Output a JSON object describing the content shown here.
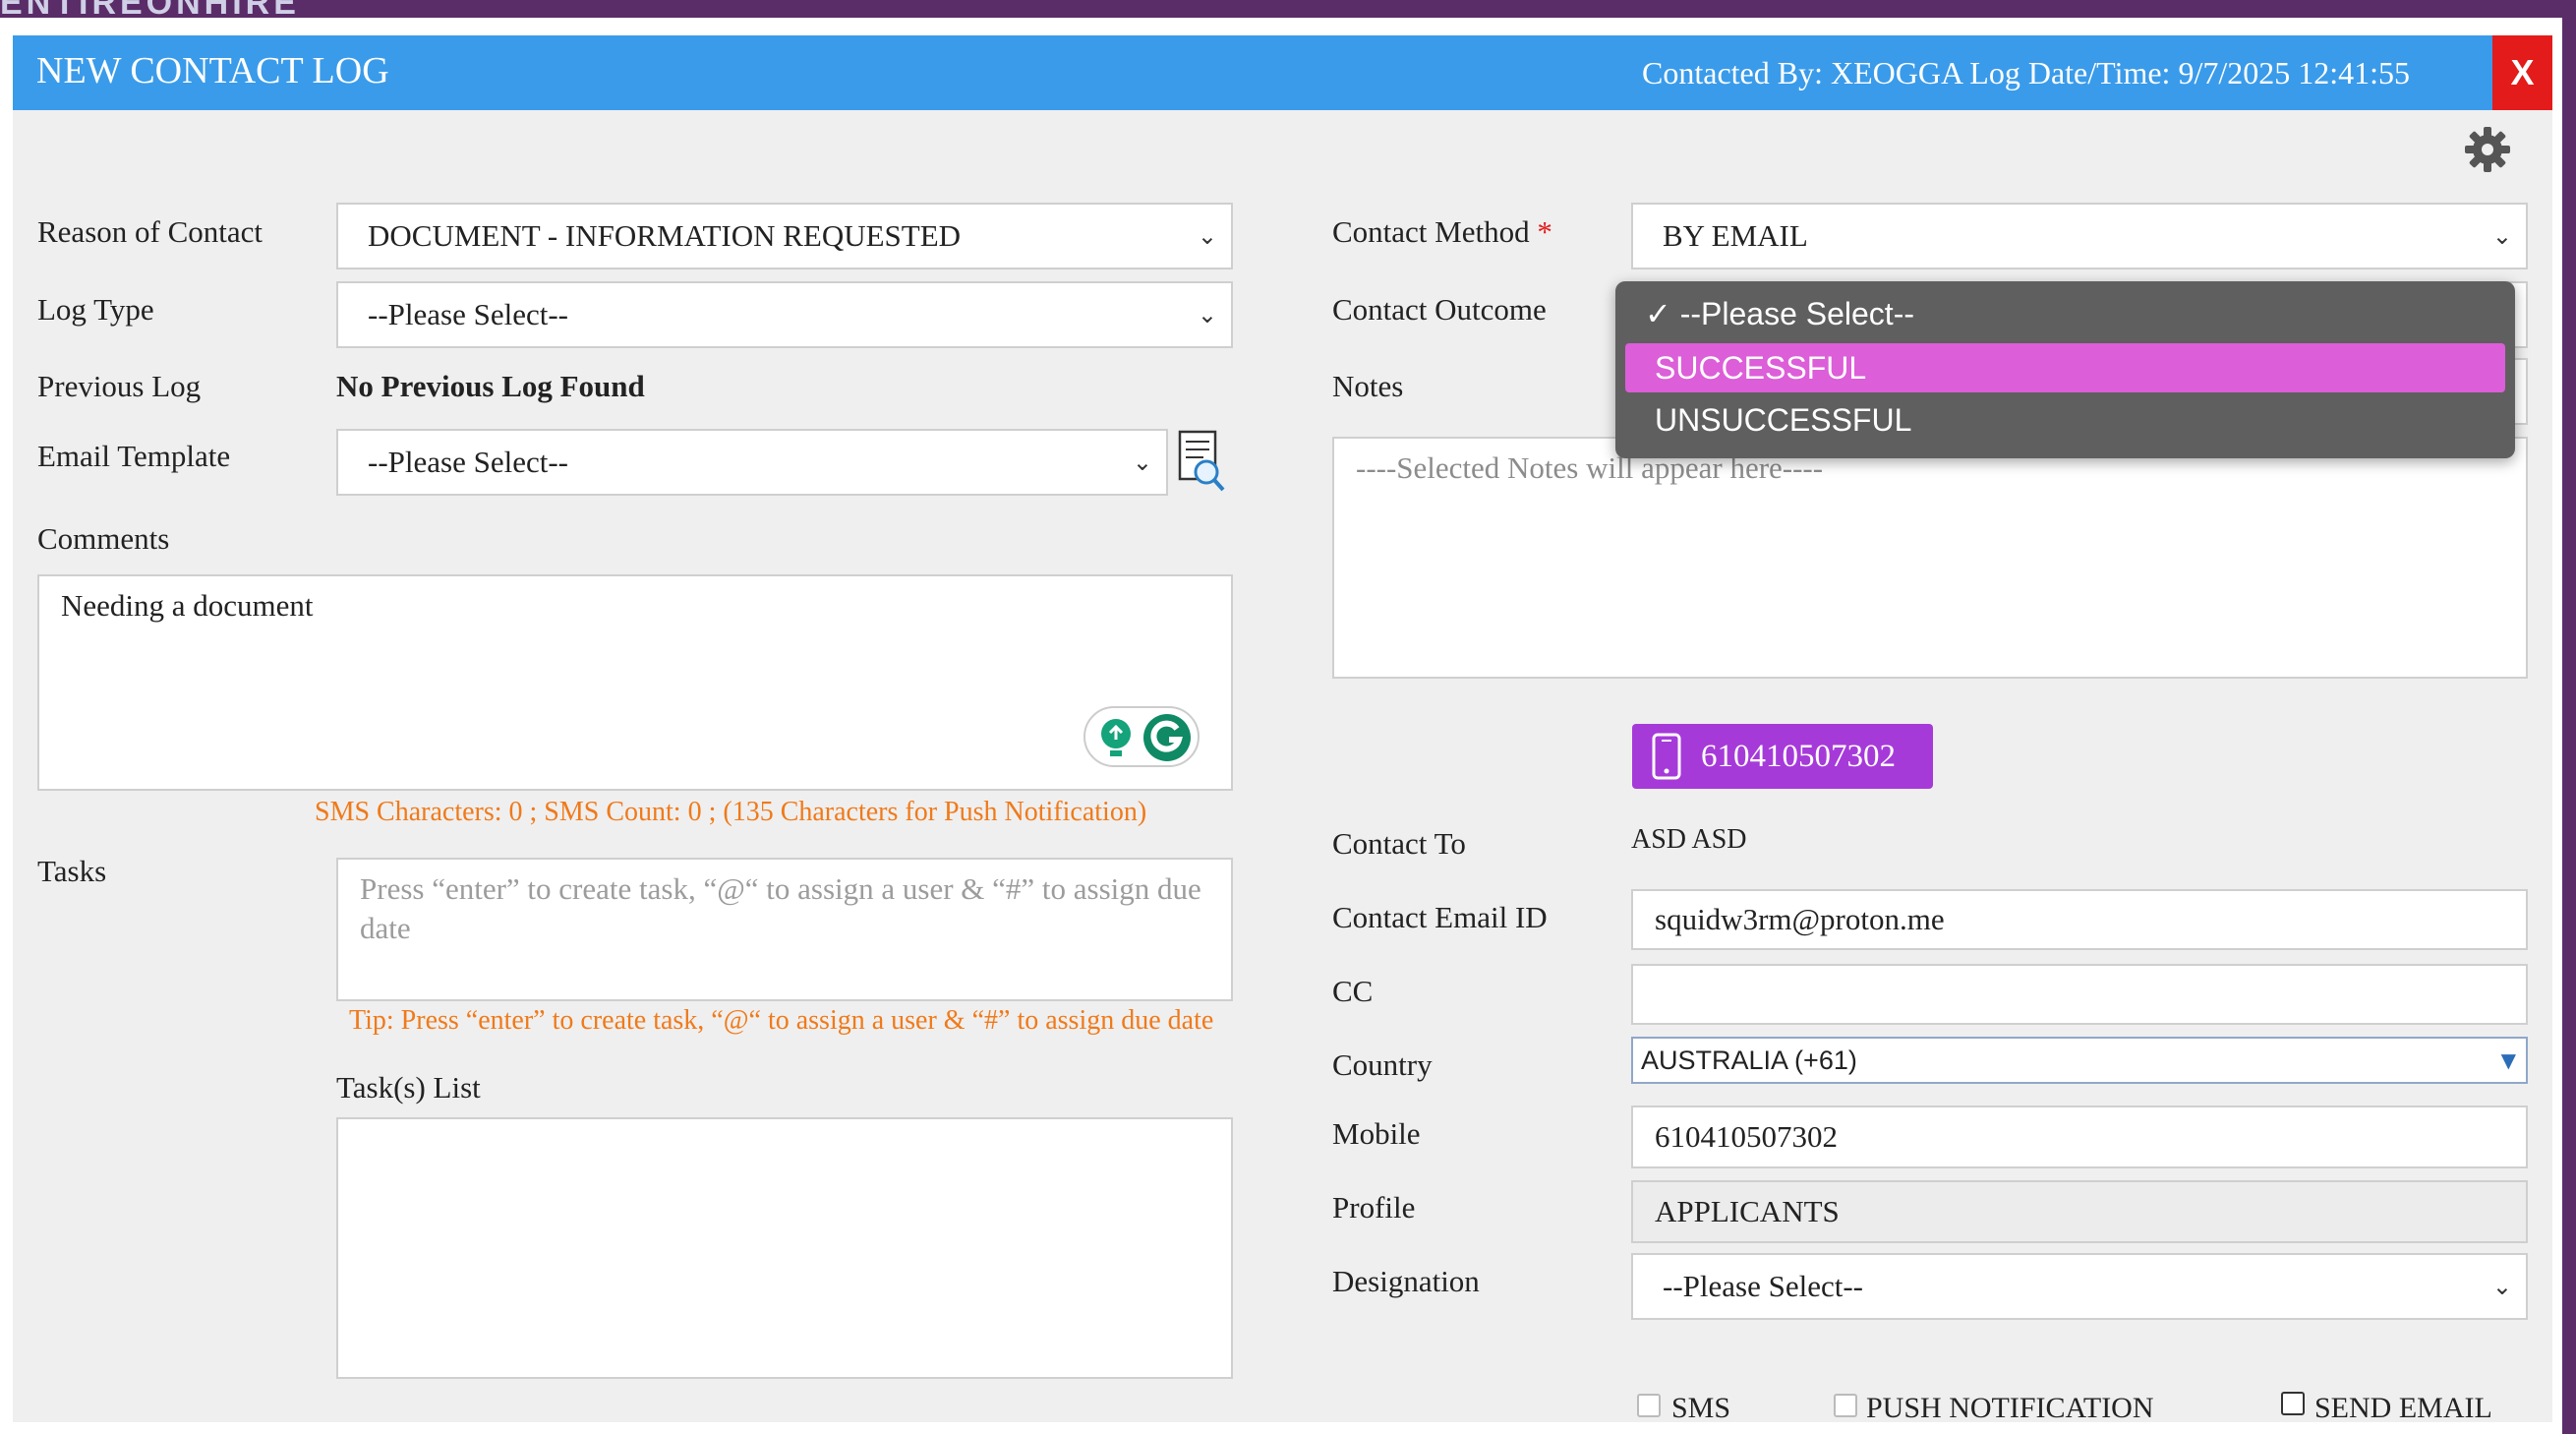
{
  "app": {
    "brand": "ENTIREONHIRE"
  },
  "header": {
    "title": "NEW CONTACT LOG",
    "meta": "Contacted By: XEOGGA  Log Date/Time: 9/7/2025 12:41:55",
    "close_label": "X"
  },
  "left": {
    "reason_label": "Reason of Contact",
    "reason_value": "DOCUMENT - INFORMATION REQUESTED",
    "logtype_label": "Log Type",
    "logtype_value": "--Please Select--",
    "prevlog_label": "Previous Log",
    "prevlog_value": "No Previous Log Found",
    "emailtpl_label": "Email Template",
    "emailtpl_value": "--Please Select--",
    "comments_label": "Comments",
    "comments_value": "Needing a document",
    "sms_counter": "SMS Characters: 0 ; SMS Count: 0 ; (135 Characters for Push Notification)",
    "tasks_label": "Tasks",
    "tasks_placeholder": "Press “enter” to create task, “@“ to assign a user & “#” to assign due date",
    "tasks_tip": "Tip: Press “enter” to create task, “@“ to assign a user & “#” to assign due date",
    "tasklist_label": "Task(s) List"
  },
  "right": {
    "method_label": "Contact Method",
    "required_mark": "*",
    "method_value": "BY EMAIL",
    "outcome_label": "Contact Outcome",
    "notes_label": "Notes",
    "notes_placeholder": "----Selected Notes will appear here----",
    "phone_badge": "610410507302",
    "contact_to_label": "Contact To",
    "contact_to_value": "ASD ASD",
    "email_label": "Contact Email ID",
    "email_value": "squidw3rm@proton.me",
    "cc_label": "CC",
    "cc_value": "",
    "country_label": "Country",
    "country_value": "AUSTRALIA (+61)",
    "mobile_label": "Mobile",
    "mobile_value": "610410507302",
    "profile_label": "Profile",
    "profile_value": "APPLICANTS",
    "designation_label": "Designation",
    "designation_value": "--Please Select--",
    "sms_check": "SMS",
    "push_check": "PUSH NOTIFICATION",
    "sendemail_check": "SEND EMAIL"
  },
  "outcome_dropdown": {
    "options": [
      {
        "label": "✓ --Please Select--",
        "selected": false
      },
      {
        "label": "SUCCESSFUL",
        "selected": true
      },
      {
        "label": "UNSUCCESSFUL",
        "selected": false
      }
    ]
  },
  "colors": {
    "header_blue": "#3a9bea",
    "close_red": "#e31b1b",
    "hint_orange": "#f07a1a",
    "badge_purple": "#a63ad9",
    "dropdown_highlight": "#dc5ed8"
  },
  "icons": {
    "settings": "gear-icon",
    "email_template_preview": "document-search-icon",
    "phone": "mobile-phone-icon",
    "grammarly": "grammarly-icon",
    "lightbulb": "lightbulb-icon"
  }
}
